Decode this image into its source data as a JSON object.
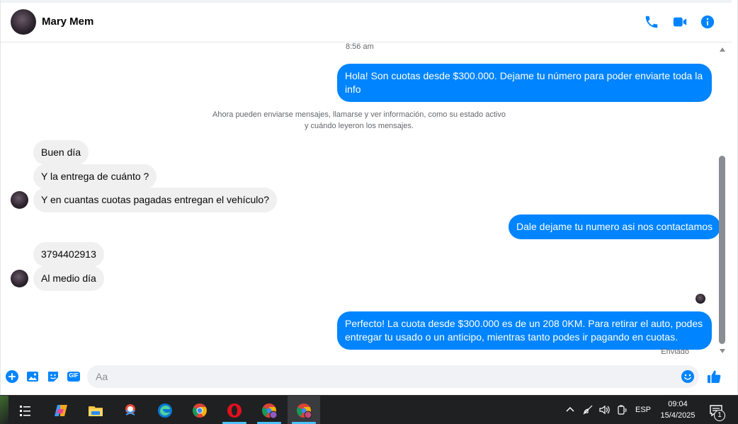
{
  "header": {
    "contact_name": "Mary Mem",
    "icons": [
      "phone-icon",
      "video-icon",
      "info-icon"
    ],
    "accent_color": "#0084ff"
  },
  "messages": {
    "timestamp": "8:56 am",
    "info_note_line1": "Ahora pueden enviarse mensajes, llamarse y ver información, como su estado activo",
    "info_note_line2": "y cuándo leyeron los mensajes.",
    "status": "Enviado",
    "items": [
      {
        "direction": "out",
        "text": "Hola! Son cuotas desde $300.000. Dejame tu número para poder enviarte toda la info"
      },
      {
        "direction": "in",
        "text": "Buen día"
      },
      {
        "direction": "in",
        "text": "Y la entrega de cuánto ?"
      },
      {
        "direction": "in",
        "text": "Y en cuantas cuotas pagadas entregan el vehículo?"
      },
      {
        "direction": "out",
        "text": "Dale dejame tu numero asi nos contactamos"
      },
      {
        "direction": "in",
        "text": "3794402913"
      },
      {
        "direction": "in",
        "text": "Al medio día"
      },
      {
        "direction": "out",
        "text": "Perfecto! La cuota desde $300.000 es de un 208 0KM. Para retirar el auto, podes entregar tu usado o un anticipo, mientras tanto podes ir pagando en cuotas."
      }
    ]
  },
  "composer": {
    "placeholder": "Aa",
    "icons": [
      "plus-icon",
      "image-icon",
      "sticker-icon",
      "gif-icon",
      "emoji-icon",
      "like-icon"
    ],
    "gif_label": "GIF"
  },
  "taskbar": {
    "apps": [
      "task-view-icon",
      "copilot-icon",
      "file-explorer-icon",
      "snipping-tool-icon",
      "edge-icon",
      "chrome-icon",
      "opera-icon",
      "chrome-profile-icon",
      "chrome-profile-2-icon"
    ],
    "language": "ESP",
    "time": "09:04",
    "date": "15/4/2025",
    "notification_count": "1"
  }
}
